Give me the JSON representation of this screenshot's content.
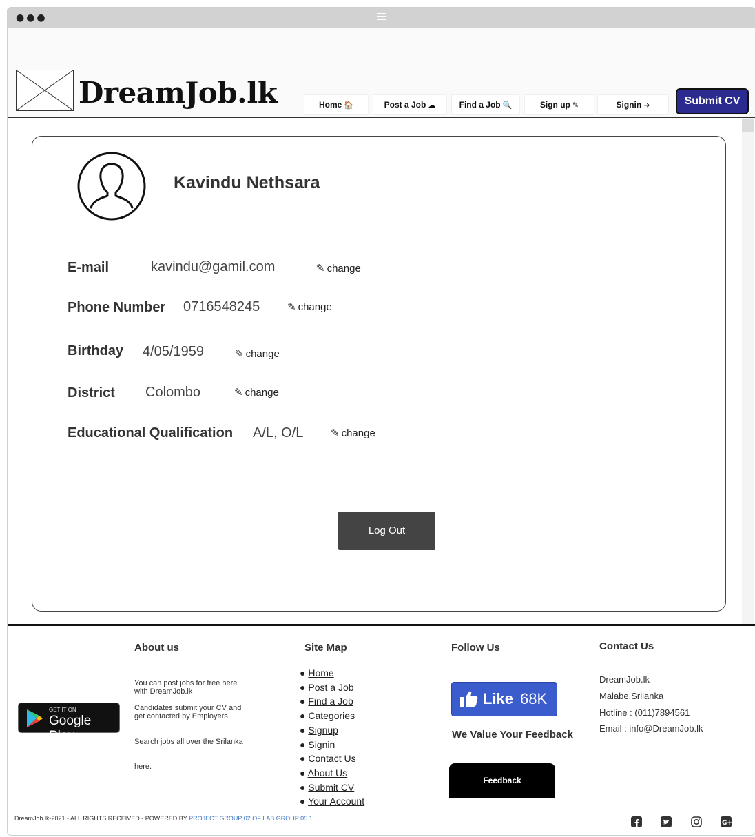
{
  "header": {
    "brand": "DreamJob.lk",
    "nav": [
      {
        "label": "Home",
        "icon": "home-icon",
        "glyph": "🏠"
      },
      {
        "label": "Post a Job",
        "icon": "cloud-upload-icon",
        "glyph": "☁"
      },
      {
        "label": "Find a Job",
        "icon": "search-icon",
        "glyph": "🔍"
      },
      {
        "label": "Sign up",
        "icon": "edit-icon",
        "glyph": "✎"
      },
      {
        "label": "Signin",
        "icon": "sign-in-icon",
        "glyph": "➜"
      }
    ],
    "submit_cv": "Submit CV"
  },
  "profile": {
    "name": "Kavindu Nethsara",
    "change_label": "change",
    "fields": [
      {
        "label": "E-mail",
        "value": "kavindu@gamil.com"
      },
      {
        "label": "Phone Number",
        "value": "0716548245"
      },
      {
        "label": "Birthday",
        "value": "4/05/1959"
      },
      {
        "label": "District",
        "value": "Colombo"
      },
      {
        "label": "Educational Qualification",
        "value": "A/L, O/L"
      }
    ],
    "logout": "Log Out"
  },
  "footer": {
    "google_play": {
      "small": "GET IT ON",
      "big": "Google Play"
    },
    "about": {
      "title": "About us",
      "lines": [
        "You can post jobs for free here with DreamJob.lk",
        "Candidates submit your CV and get contacted by Employers.",
        "Search jobs all over the Srilanka",
        "here."
      ]
    },
    "sitemap": {
      "title": "Site Map",
      "items": [
        "Home",
        "Post a Job",
        "Find a Job",
        "Categories",
        "Signup",
        "Signin",
        "Contact Us",
        "About Us",
        "Submit CV",
        "Your Account"
      ]
    },
    "follow": {
      "title": "Follow Us",
      "like_label": "Like",
      "like_count": "68K",
      "value_text": "We Value Your Feedback",
      "feedback_button": "Feedback"
    },
    "contact": {
      "title": "Contact Us",
      "lines": [
        "DreamJob.lk",
        "Malabe,Srilanka",
        "Hotline : (011)7894561",
        "Email  : info@DreamJob.lk"
      ]
    },
    "copyright": "DreamJob.lk-2021 - ALL RIGHTS RECEIVED - POWERED BY",
    "powered_by": "PROJECT GROUP 02 OF LAB GROUP 05.1",
    "accent_color": "#3a76c4"
  },
  "colors": {
    "submit_cv_bg": "#2b2b8f",
    "facebook_blue": "#3b5ccc"
  }
}
